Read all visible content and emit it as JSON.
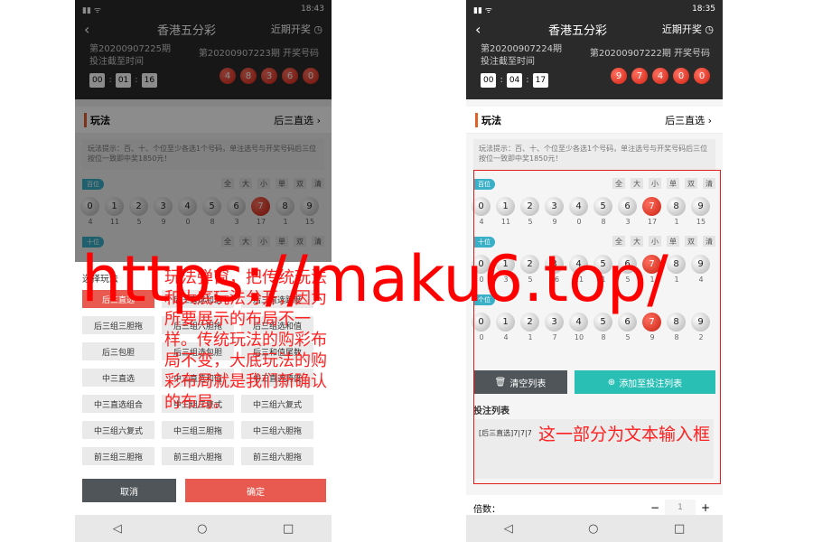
{
  "left": {
    "status": {
      "time": "18:43"
    },
    "title": "香港五分彩",
    "recent": "近期开奖",
    "current_issue": "第20200907225期",
    "deadline_label": "投注截至时间",
    "timer": [
      "00",
      "01",
      "16"
    ],
    "last_issue": "第20200907223期 开奖号码",
    "last_numbers": [
      "4",
      "8",
      "3",
      "6",
      "0"
    ],
    "play_label": "玩法",
    "play_value": "后三直选",
    "tip": "玩法提示：百、十、个位至少各选1个号码，单注选号与开奖号码后三位按位一致即中奖1850元！",
    "sections": [
      {
        "tag": "百位",
        "filters": [
          "全",
          "大",
          "小",
          "单",
          "双",
          "清"
        ],
        "numbers": [
          "0",
          "1",
          "2",
          "3",
          "4",
          "5",
          "6",
          "7",
          "8",
          "9"
        ],
        "selected": [
          7
        ],
        "missing": [
          "4",
          "11",
          "5",
          "9",
          "0",
          "8",
          "3",
          "17",
          "1",
          "15"
        ]
      },
      {
        "tag": "十位",
        "filters": [
          "全",
          "大",
          "小",
          "单",
          "双",
          "清"
        ]
      }
    ],
    "sheet_title": "选择玩法",
    "options": [
      [
        "后三直选",
        "后三直选和值",
        "后三直选跨度"
      ],
      [
        "后三组三胆拖",
        "后三组六胆拖",
        "后三组选和值"
      ],
      [
        "后三包胆",
        "后三组选包胆",
        "后三和值尾数"
      ],
      [
        "中三直选",
        "中三直选和值",
        "中三直选跨度"
      ],
      [
        "中三直选组合",
        "中三组三复式",
        "中三组六复式"
      ],
      [
        "中三组六复式",
        "中三组三胆拖",
        "中三组六胆拖"
      ],
      [
        "前三组三胆拖",
        "前三组六胆拖",
        "前三组六胆拖"
      ]
    ],
    "cancel": "取消",
    "confirm": "确定"
  },
  "right": {
    "status": {
      "time": "18:35"
    },
    "title": "香港五分彩",
    "recent": "近期开奖",
    "current_issue": "第20200907224期",
    "deadline_label": "投注截至时间",
    "timer": [
      "00",
      "04",
      "17"
    ],
    "last_issue": "第20200907222期 开奖号码",
    "last_numbers": [
      "9",
      "7",
      "4",
      "0",
      "0"
    ],
    "play_label": "玩法",
    "play_value": "后三直选",
    "tip": "玩法提示：百、十、个位至少各选1个号码，单注选号与开奖号码后三位按位一致即中奖1850元！",
    "sections": [
      {
        "tag": "百位",
        "filters": [
          "全",
          "大",
          "小",
          "单",
          "双",
          "清"
        ],
        "numbers": [
          "0",
          "1",
          "2",
          "3",
          "4",
          "5",
          "6",
          "7",
          "8",
          "9"
        ],
        "selected": [
          7
        ],
        "missing": [
          "4",
          "11",
          "5",
          "9",
          "0",
          "8",
          "3",
          "17",
          "1",
          "15"
        ]
      },
      {
        "tag": "十位",
        "filters": [
          "全",
          "大",
          "小",
          "单",
          "双",
          "清"
        ],
        "numbers": [
          "0",
          "1",
          "2",
          "3",
          "4",
          "5",
          "6",
          "7",
          "8",
          "9"
        ],
        "selected": [
          7
        ],
        "missing": [
          "0",
          "3",
          "5",
          "16",
          "11",
          "1",
          "5",
          "1",
          "1",
          "4"
        ]
      },
      {
        "tag": "个位",
        "filters": [],
        "numbers": [
          "0",
          "1",
          "2",
          "3",
          "4",
          "5",
          "6",
          "7",
          "8",
          "9"
        ],
        "selected": [
          7
        ],
        "missing": [
          "0",
          "4",
          "1",
          "7",
          "10",
          "8",
          "5",
          "9",
          "8",
          "2"
        ]
      }
    ],
    "clear": "清空列表",
    "add": "添加至投注列表",
    "list_label": "投注列表",
    "list_entry": "[后三直选]7|7|7",
    "multiplier_label": "倍数：",
    "multiplier_value": "1"
  },
  "watermark": "https://maku6.top/",
  "note_left": "玩法弹窗，把传统玩法和大底玩法分开，因为所要展示的布局不一样。传统玩法的购彩布局不变，大底玩法的购彩布局就是我们新确认的布局。",
  "note_right": "这一部分为文本输入框",
  "colors": {
    "accent_red": "#e85a4f",
    "teal": "#2abfb5",
    "annotation": "#ff2020"
  }
}
